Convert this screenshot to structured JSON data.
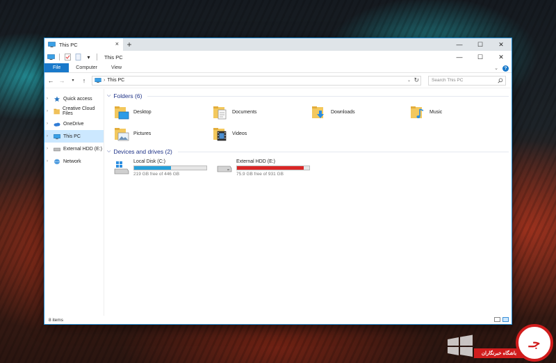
{
  "window": {
    "tab_title": "This PC",
    "tab_add": "+",
    "title": "This PC",
    "controls": {
      "minimize": "—",
      "maximize": "☐",
      "close": "✕"
    }
  },
  "ribbon": {
    "tabs": [
      "File",
      "Computer",
      "View"
    ]
  },
  "navbar": {
    "address": "This PC",
    "search_placeholder": "Search This PC"
  },
  "sidebar": {
    "items": [
      {
        "label": "Quick access",
        "icon": "star-icon",
        "color": "#2b78c2"
      },
      {
        "label": "Creative Cloud Files",
        "icon": "cloud-folder-icon",
        "color": "#e8b24a"
      },
      {
        "label": "OneDrive",
        "icon": "onedrive-icon",
        "color": "#2f7cd6"
      },
      {
        "label": "This PC",
        "icon": "pc-icon",
        "color": "#2f88d6"
      },
      {
        "label": "External HDD (E:)",
        "icon": "drive-icon",
        "color": "#777777"
      },
      {
        "label": "Network",
        "icon": "network-icon",
        "color": "#2f88d6"
      }
    ]
  },
  "folders": {
    "header": "Folders (6)",
    "items": [
      {
        "label": "Desktop",
        "badge": "desktop"
      },
      {
        "label": "Documents",
        "badge": "documents"
      },
      {
        "label": "Downloads",
        "badge": "downloads"
      },
      {
        "label": "Music",
        "badge": "music"
      },
      {
        "label": "Pictures",
        "badge": "pictures"
      },
      {
        "label": "Videos",
        "badge": "videos"
      }
    ]
  },
  "drives": {
    "header": "Devices and drives (2)",
    "items": [
      {
        "label": "Local Disk (C:)",
        "free": "219 GB free of 446 GB",
        "used_fraction": 0.51,
        "bar_color": "#26a0da",
        "icon": "windows-drive-icon"
      },
      {
        "label": "External HDD (E:)",
        "free": "75.9 GB free of 931 GB",
        "used_fraction": 0.92,
        "bar_color": "#da2626",
        "icon": "external-drive-icon"
      }
    ]
  },
  "status": {
    "items_count": "8 items"
  },
  "watermark": {
    "banner": "باشگاه خبرنگاران",
    "mark": "جـ"
  },
  "colors": {
    "accent": "#1979ca",
    "selection": "#cce8ff",
    "header_text": "#1e3287"
  }
}
